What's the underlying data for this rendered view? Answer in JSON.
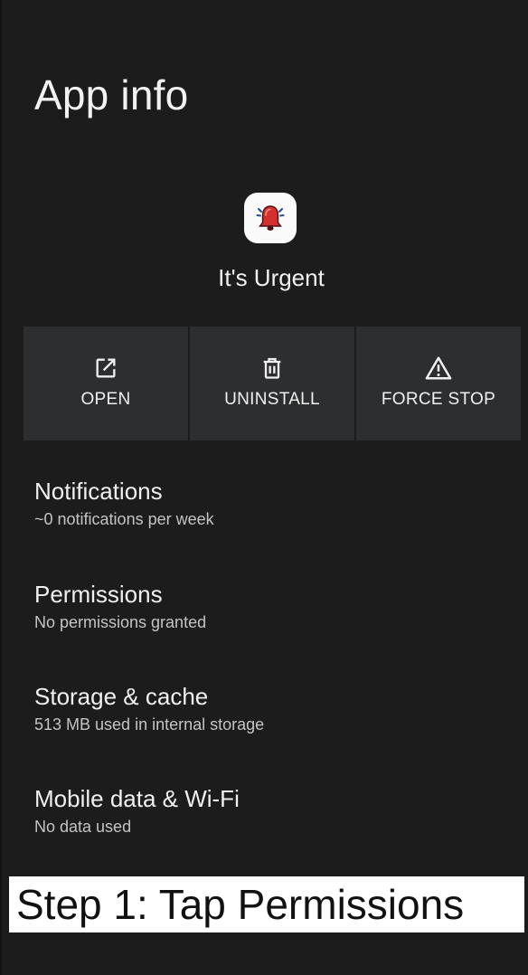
{
  "header": {
    "title": "App info"
  },
  "app": {
    "name": "It's Urgent",
    "icon": "alarm-bell-icon"
  },
  "actions": [
    {
      "label": "OPEN",
      "icon": "open-external-icon"
    },
    {
      "label": "UNINSTALL",
      "icon": "trash-icon"
    },
    {
      "label": "FORCE STOP",
      "icon": "warning-icon"
    }
  ],
  "settings": [
    {
      "title": "Notifications",
      "summary": "~0 notifications per week"
    },
    {
      "title": "Permissions",
      "summary": "No permissions granted"
    },
    {
      "title": "Storage & cache",
      "summary": "513 MB used in internal storage"
    },
    {
      "title": "Mobile data & Wi-Fi",
      "summary": "No data used"
    }
  ],
  "caption": {
    "text": "Step 1: Tap Permissions"
  },
  "colors": {
    "background": "#1c1c1c",
    "action_panel": "#2d2e30",
    "icon_red": "#d32f2f"
  }
}
